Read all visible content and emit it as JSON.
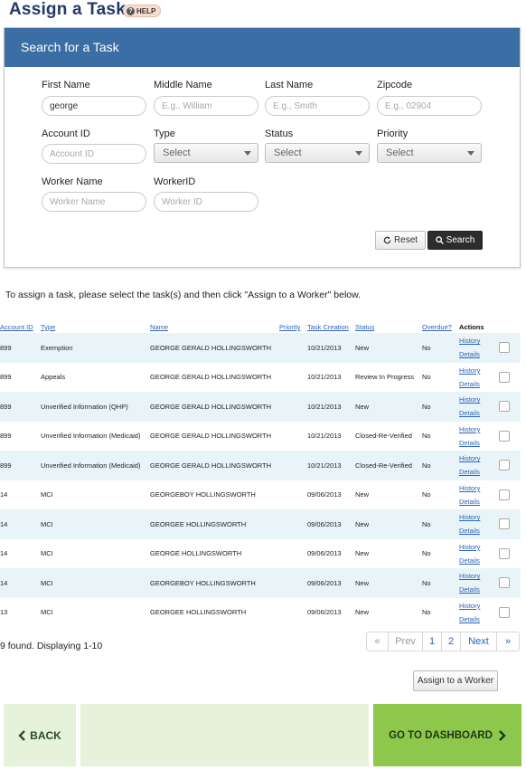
{
  "page": {
    "title": "Assign a Task",
    "help_label": "HELP"
  },
  "search_panel": {
    "title": "Search for a Task",
    "fields": {
      "first_name": {
        "label": "First Name",
        "value": "george",
        "placeholder": ""
      },
      "middle_name": {
        "label": "Middle Name",
        "value": "",
        "placeholder": "E.g., William"
      },
      "last_name": {
        "label": "Last Name",
        "value": "",
        "placeholder": "E.g., Smith"
      },
      "zipcode": {
        "label": "Zipcode",
        "value": "",
        "placeholder": "E.g., 02904"
      },
      "account_id": {
        "label": "Account ID",
        "value": "",
        "placeholder": "Account ID"
      },
      "type": {
        "label": "Type",
        "selected": "Select"
      },
      "status": {
        "label": "Status",
        "selected": "Select"
      },
      "priority": {
        "label": "Priority",
        "selected": "Select"
      },
      "worker_name": {
        "label": "Worker Name",
        "value": "",
        "placeholder": "Worker Name"
      },
      "worker_id": {
        "label": "WorkerID",
        "value": "",
        "placeholder": "Worker ID"
      }
    },
    "reset_label": "Reset",
    "search_label": "Search"
  },
  "instructions": "To assign a task, please select the task(s) and then click \"Assign to a Worker\" below.",
  "table": {
    "headers": [
      "Account ID",
      "Type",
      "Name",
      "Priority",
      "Task Creation",
      "Status",
      "Overdue?",
      "Actions"
    ],
    "rows": [
      {
        "account_id": "899",
        "type": "Exemption",
        "name": "GEORGE GERALD HOLLINGSWORTH",
        "priority": "",
        "task_creation": "10/21/2013",
        "status": "New",
        "overdue": "No"
      },
      {
        "account_id": "899",
        "type": "Appeals",
        "name": "GEORGE GERALD HOLLINGSWORTH",
        "priority": "",
        "task_creation": "10/21/2013",
        "status": "Review In Progress",
        "overdue": "No"
      },
      {
        "account_id": "899",
        "type": "Unverified Information (QHP)",
        "name": "GEORGE GERALD HOLLINGSWORTH",
        "priority": "",
        "task_creation": "10/21/2013",
        "status": "New",
        "overdue": "No"
      },
      {
        "account_id": "899",
        "type": "Unverified Information (Medicaid)",
        "name": "GEORGE GERALD HOLLINGSWORTH",
        "priority": "",
        "task_creation": "10/21/2013",
        "status": "Closed-Re-Verified",
        "overdue": "No"
      },
      {
        "account_id": "899",
        "type": "Unverified Information (Medicaid)",
        "name": "GEORGE GERALD HOLLINGSWORTH",
        "priority": "",
        "task_creation": "10/21/2013",
        "status": "Closed-Re-Verified",
        "overdue": "No"
      },
      {
        "account_id": "14",
        "type": "MCI",
        "name": "GEORGEBOY HOLLINGSWORTH",
        "priority": "",
        "task_creation": "09/06/2013",
        "status": "New",
        "overdue": "No"
      },
      {
        "account_id": "14",
        "type": "MCI",
        "name": "GEORGEE HOLLINGSWORTH",
        "priority": "",
        "task_creation": "09/06/2013",
        "status": "New",
        "overdue": "No"
      },
      {
        "account_id": "14",
        "type": "MCI",
        "name": "GEORGE HOLLINGSWORTH",
        "priority": "",
        "task_creation": "09/06/2013",
        "status": "New",
        "overdue": "No"
      },
      {
        "account_id": "14",
        "type": "MCI",
        "name": "GEORGEBOY HOLLINGSWORTH",
        "priority": "",
        "task_creation": "09/06/2013",
        "status": "New",
        "overdue": "No"
      },
      {
        "account_id": "13",
        "type": "MCI",
        "name": "GEORGEE HOLLINGSWORTH",
        "priority": "",
        "task_creation": "09/06/2013",
        "status": "New",
        "overdue": "No"
      }
    ],
    "action_history": "History",
    "action_details": "Details"
  },
  "pagination": {
    "summary": "9 found. Displaying 1-10",
    "first": "«",
    "prev": "Prev",
    "pages": [
      "1",
      "2"
    ],
    "next": "Next",
    "last": "»"
  },
  "assign_button_label": "Assign to a Worker",
  "footer": {
    "back_label": "BACK",
    "dashboard_label": "GO TO DASHBOARD"
  }
}
